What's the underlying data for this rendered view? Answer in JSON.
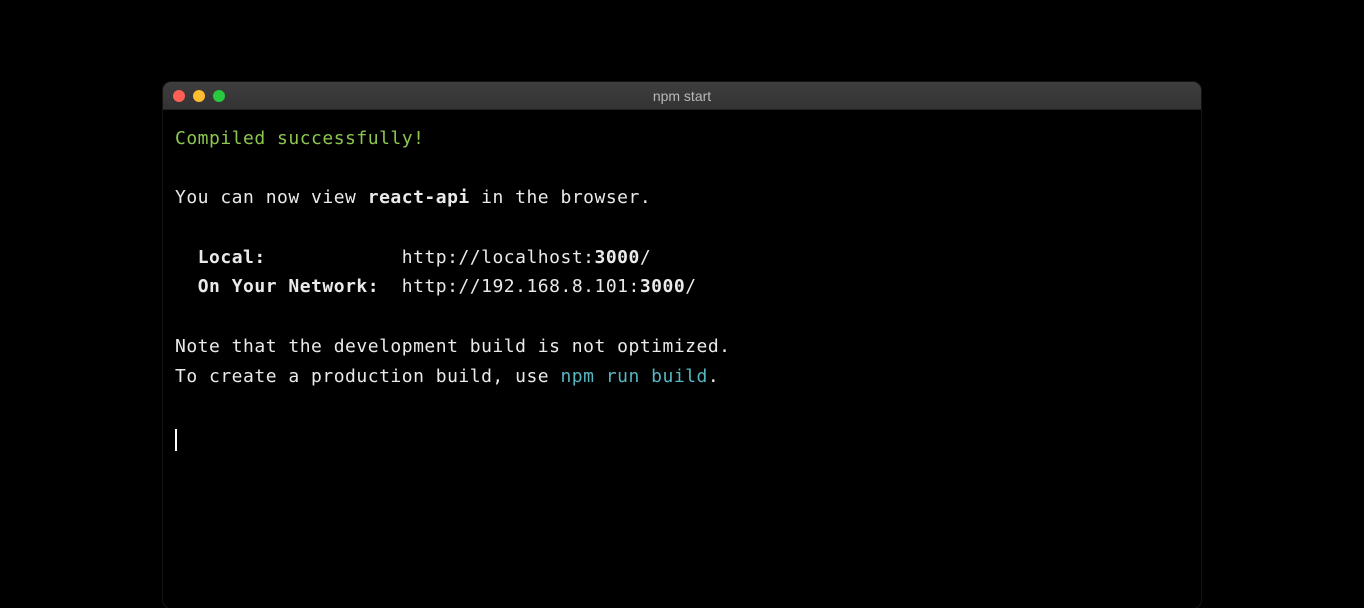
{
  "window": {
    "title": "npm start"
  },
  "terminal": {
    "success_message": "Compiled successfully!",
    "view_prefix": "You can now view ",
    "app_name": "react-api",
    "view_suffix": " in the browser.",
    "local_label": "Local:",
    "local_url_prefix": "http://localhost:",
    "local_port": "3000",
    "local_url_suffix": "/",
    "network_label": "On Your Network:",
    "network_url_prefix": "http://192.168.8.101:",
    "network_port": "3000",
    "network_url_suffix": "/",
    "note_line1": "Note that the development build is not optimized.",
    "note_line2_prefix": "To create a production build, use ",
    "build_command": "npm run build",
    "note_line2_suffix": "."
  }
}
